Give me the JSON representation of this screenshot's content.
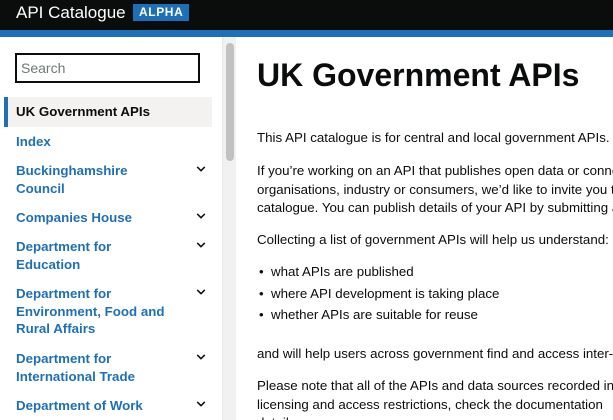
{
  "header": {
    "title": "API Catalogue",
    "badge": "ALPHA"
  },
  "colors": {
    "header_bg": "#0b0c0c",
    "accent": "#1d70b8",
    "link": "#1d70b8",
    "text": "#0b0c0c"
  },
  "sidebar": {
    "search_placeholder": "Search",
    "items": [
      {
        "label": "UK Government APIs",
        "active": true,
        "expandable": false
      },
      {
        "label": "Index",
        "active": false,
        "expandable": false
      },
      {
        "label": "Buckinghamshire Council",
        "active": false,
        "expandable": true,
        "icon": "chevron-down-icon"
      },
      {
        "label": "Companies House",
        "active": false,
        "expandable": true,
        "icon": "chevron-down-icon"
      },
      {
        "label": "Department for Education",
        "active": false,
        "expandable": true,
        "icon": "chevron-down-icon"
      },
      {
        "label": "Department for Environment, Food and Rural Affairs",
        "active": false,
        "expandable": true,
        "icon": "chevron-down-icon"
      },
      {
        "label": "Department for International Trade",
        "active": false,
        "expandable": true,
        "icon": "chevron-down-icon"
      },
      {
        "label": "Department of Work",
        "active": false,
        "expandable": true,
        "icon": "chevron-down-icon"
      }
    ]
  },
  "main": {
    "title": "UK Government APIs",
    "paragraphs": [
      "This API catalogue is for central and local government APIs.",
      "If you’re working on an API that publishes open data or conne",
      "organisations, industry or consumers, we’d like to invite you t",
      "catalogue. You can publish details of your API by submitting a",
      "Collecting a list of government APIs will help us understand:",
      "and will help users across government find and access inter-o",
      "Please note that all of the APIs and data sources recorded in",
      "licensing and access restrictions, check the documentation",
      "details"
    ],
    "bullets": [
      "what APIs are published",
      "where API development is taking place",
      "whether APIs are suitable for reuse"
    ]
  }
}
